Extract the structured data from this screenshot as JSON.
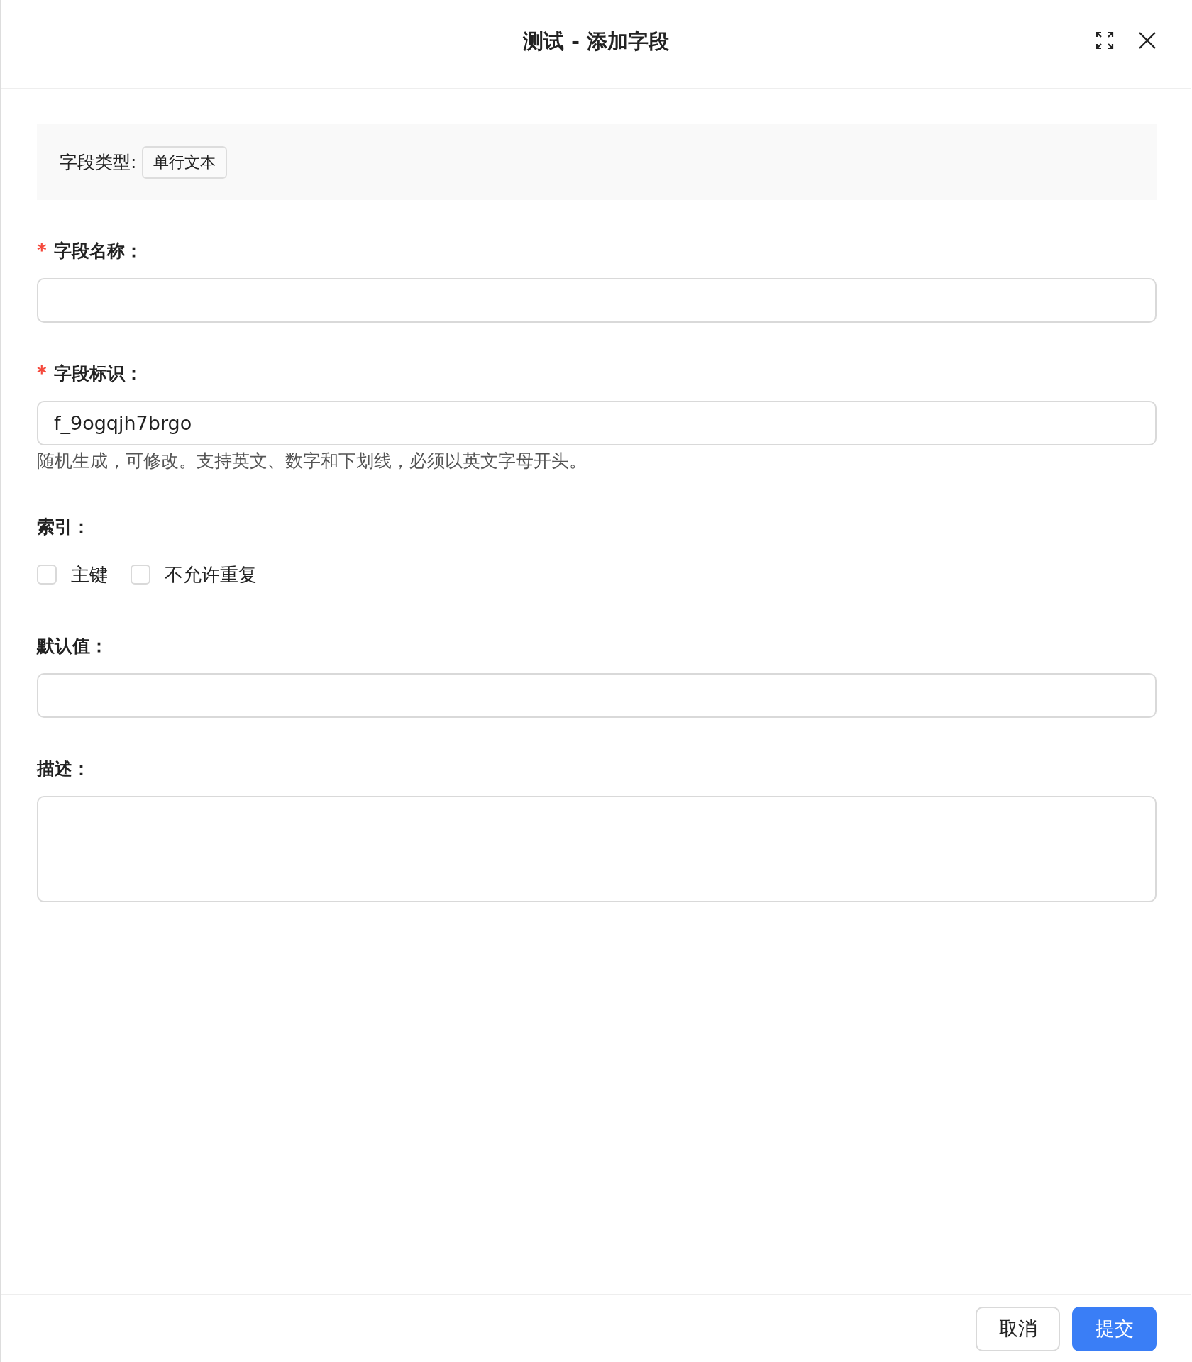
{
  "dialog": {
    "title": "测试 - 添加字段"
  },
  "field_type": {
    "label": "字段类型:",
    "value": "单行文本"
  },
  "form": [
    {
      "kind": "input",
      "label": "字段名称：",
      "required_mark": "*"
    },
    {
      "kind": "input",
      "label": "字段标识：",
      "required_mark": "*",
      "value": "f_9ogqjh7brgo",
      "help": "随机生成，可修改。支持英文、数字和下划线，必须以英文字母开头。"
    },
    {
      "kind": "checkboxes",
      "label": "索引：",
      "options": [
        {
          "label": "主键",
          "checked": false
        },
        {
          "label": "不允许重复",
          "checked": false
        }
      ]
    },
    {
      "kind": "input",
      "label": "默认值："
    },
    {
      "kind": "textarea",
      "label": "描述："
    }
  ],
  "buttons": [
    {
      "label": "取消",
      "primary": false
    },
    {
      "label": "提交",
      "primary": true
    }
  ]
}
